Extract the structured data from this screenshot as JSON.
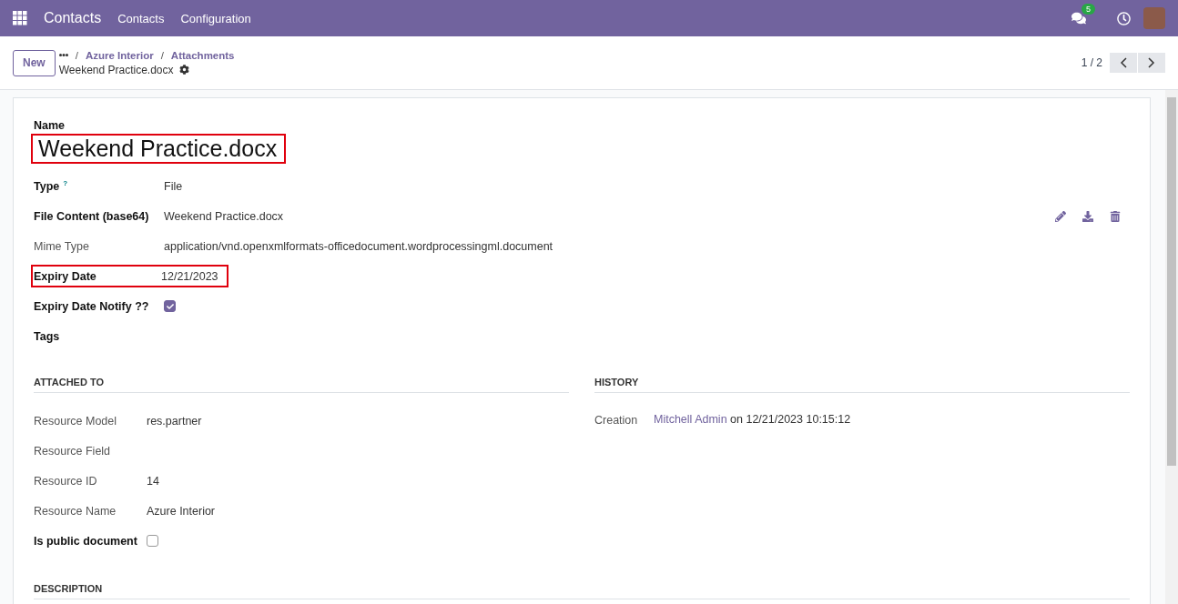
{
  "navbar": {
    "app": "Contacts",
    "menus": [
      "Contacts",
      "Configuration"
    ],
    "notifications": "5"
  },
  "control_panel": {
    "new_button": "New",
    "breadcrumbs": [
      {
        "separator": "/",
        "label": "Azure Interior"
      },
      {
        "separator": "/",
        "label": "Attachments"
      }
    ],
    "record_title": "Weekend Practice.docx",
    "pager": "1 / 2"
  },
  "form": {
    "name_label": "Name",
    "name": "Weekend Practice.docx",
    "name_highlighted": true,
    "fields": [
      {
        "kind": "text",
        "label": "Type",
        "bold": true,
        "help": "?",
        "value": "File",
        "highlighted": false
      },
      {
        "kind": "file",
        "label": "File Content (base64)",
        "bold": true,
        "value": "Weekend Practice.docx",
        "highlighted": false
      },
      {
        "kind": "text",
        "label": "Mime Type",
        "bold": false,
        "value": "application/vnd.openxmlformats-officedocument.wordprocessingml.document",
        "highlighted": false
      },
      {
        "kind": "text",
        "label": "Expiry Date",
        "bold": true,
        "value": "12/21/2023",
        "highlighted": true
      },
      {
        "kind": "checkbox",
        "label": "Expiry Date Notify ??",
        "bold": true,
        "checked": true,
        "highlighted": false
      },
      {
        "kind": "text",
        "label": "Tags",
        "bold": true,
        "highlighted": false
      }
    ],
    "attached_to": {
      "title": "ATTACHED TO",
      "fields": [
        {
          "kind": "text",
          "label": "Resource Model",
          "bold": false,
          "value": "res.partner"
        },
        {
          "kind": "text",
          "label": "Resource Field",
          "bold": false
        },
        {
          "kind": "text",
          "label": "Resource ID",
          "bold": false,
          "value": "14"
        },
        {
          "kind": "text",
          "label": "Resource Name",
          "bold": false,
          "value": "Azure Interior"
        },
        {
          "kind": "checkbox",
          "label": "Is public document",
          "bold": true,
          "checked": false
        }
      ]
    },
    "history": {
      "title": "HISTORY",
      "label": "Creation",
      "user": "Mitchell Admin",
      "when": "on 12/21/2023 10:15:12"
    },
    "description_title": "DESCRIPTION"
  }
}
